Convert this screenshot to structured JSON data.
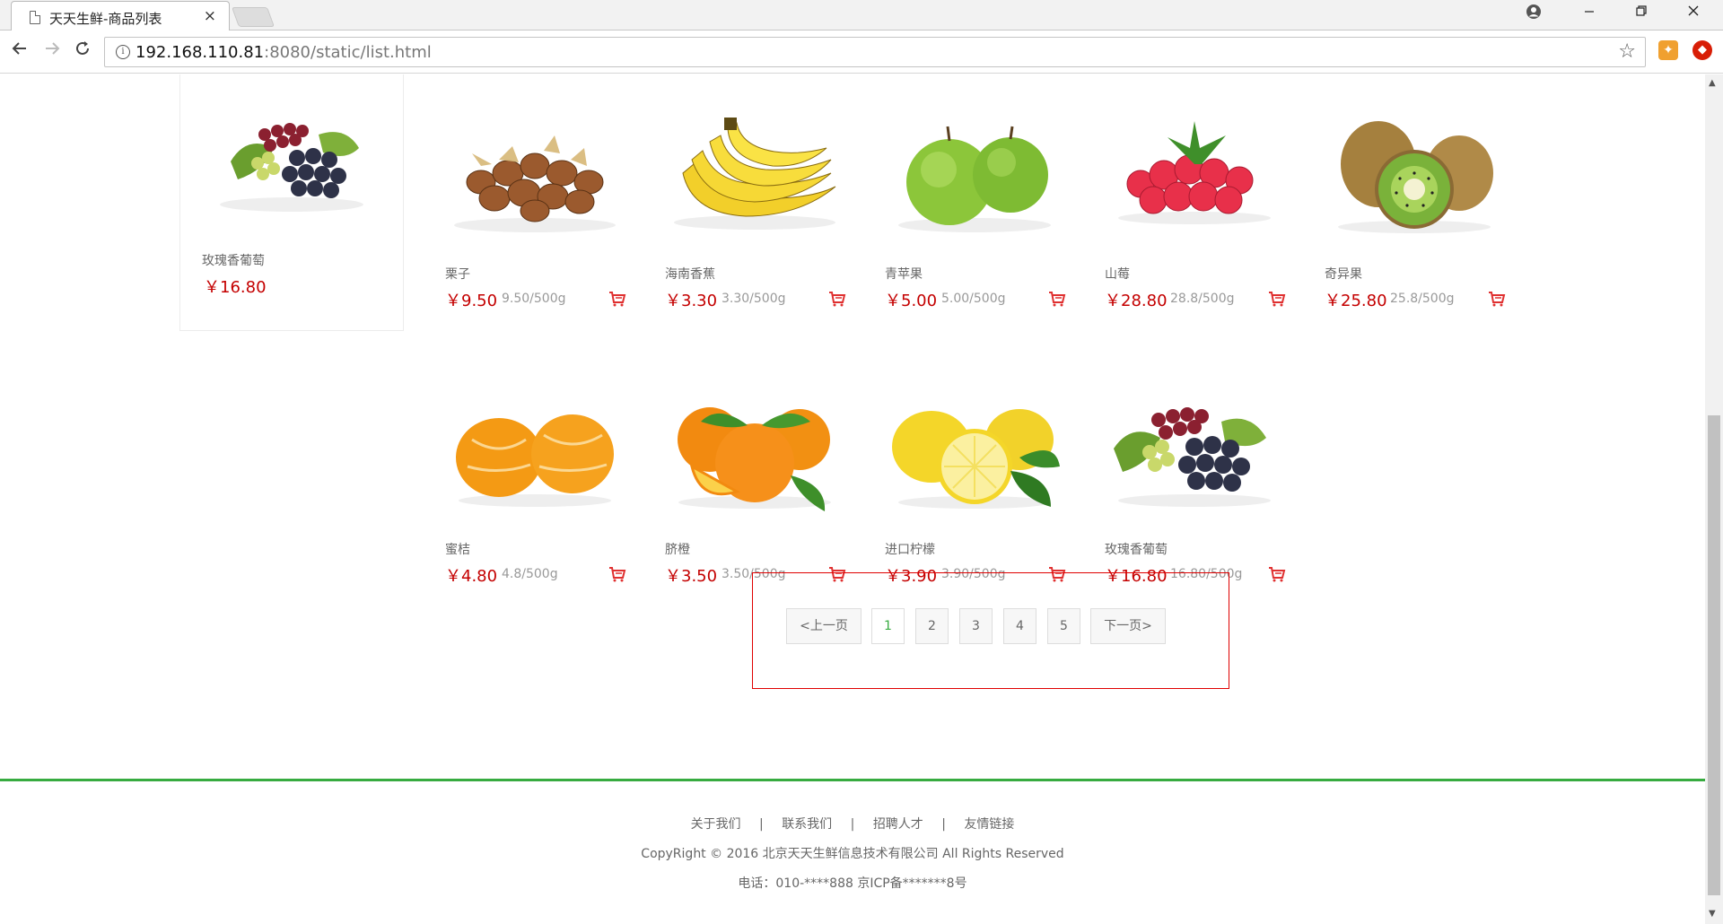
{
  "browser": {
    "tab_title": "天天生鲜-商品列表",
    "tab_close": "×",
    "url_host": "192.168.110.81",
    "url_rest": ":8080/static/list.html"
  },
  "recommend": {
    "name": "玫瑰香葡萄",
    "price": "￥16.80"
  },
  "products": [
    {
      "name": "栗子",
      "price": "￥9.50",
      "unit": "9.50/500g",
      "image": "chestnut"
    },
    {
      "name": "海南香蕉",
      "price": "￥3.30",
      "unit": "3.30/500g",
      "image": "banana"
    },
    {
      "name": "青苹果",
      "price": "￥5.00",
      "unit": "5.00/500g",
      "image": "green-apple"
    },
    {
      "name": "山莓",
      "price": "￥28.80",
      "unit": "28.8/500g",
      "image": "raspberry"
    },
    {
      "name": "奇异果",
      "price": "￥25.80",
      "unit": "25.8/500g",
      "image": "kiwi"
    },
    {
      "name": "蜜桔",
      "price": "￥4.80",
      "unit": "4.8/500g",
      "image": "tangerine"
    },
    {
      "name": "脐橙",
      "price": "￥3.50",
      "unit": "3.50/500g",
      "image": "navel-orange"
    },
    {
      "name": "进口柠檬",
      "price": "￥3.90",
      "unit": "3.90/500g",
      "image": "lemon"
    },
    {
      "name": "玫瑰香葡萄",
      "price": "￥16.80",
      "unit": "16.80/500g",
      "image": "grape"
    }
  ],
  "pagination": {
    "prev": "<上一页",
    "pages": [
      "1",
      "2",
      "3",
      "4",
      "5"
    ],
    "current": "1",
    "next": "下一页>"
  },
  "footer": {
    "links": [
      "关于我们",
      "联系我们",
      "招聘人才",
      "友情链接"
    ],
    "separator": "|",
    "copyright": "CopyRight © 2016 北京天天生鲜信息技术有限公司 All Rights Reserved",
    "tel": "电话：010-****888 京ICP备*******8号"
  },
  "colors": {
    "price": "#c40000",
    "accent_green": "#37ab40",
    "pager_border": "#e00000"
  }
}
